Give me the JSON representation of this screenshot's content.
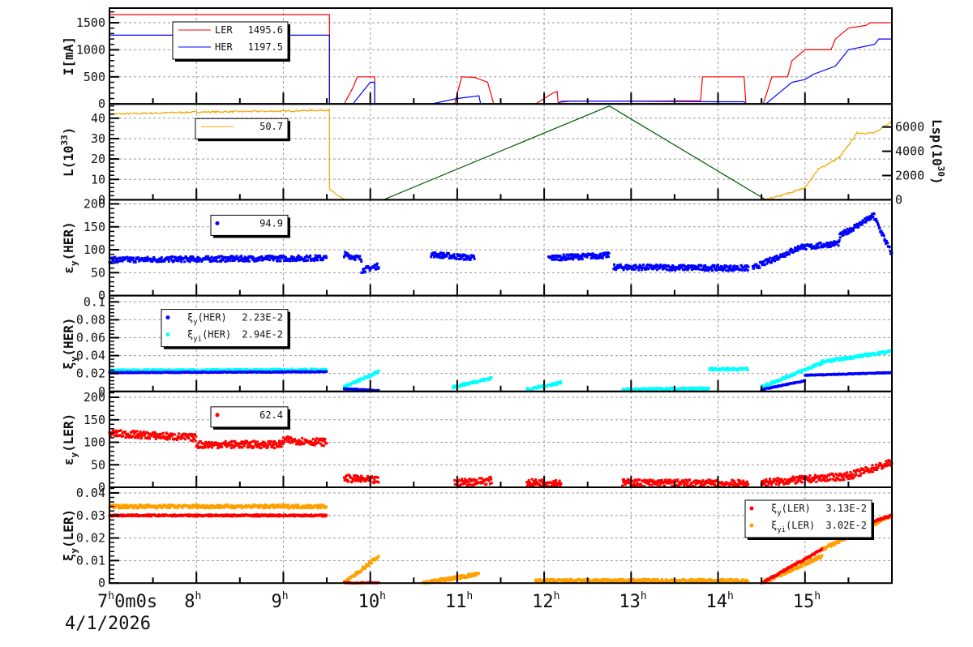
{
  "chart_data": {
    "type": "line",
    "x_range_hours": [
      7,
      16
    ],
    "x_tick_labels": [
      {
        "h": "7",
        "rest": "0m0s"
      },
      {
        "h": "8"
      },
      {
        "h": "9"
      },
      {
        "h": "10"
      },
      {
        "h": "11"
      },
      {
        "h": "12"
      },
      {
        "h": "13"
      },
      {
        "h": "14"
      },
      {
        "h": "15"
      }
    ],
    "x_hour_sup": "h",
    "date_label": "4/1/2026",
    "panels": [
      {
        "id": "current",
        "ylabel": {
          "main": "I[mA]"
        },
        "ylim": [
          0,
          1770
        ],
        "yticks": [
          0,
          500,
          1000,
          1500
        ],
        "legend": [
          {
            "name": "LER",
            "value": "1495.6",
            "color": "#ff0000",
            "kind": "line"
          },
          {
            "name": "HER",
            "value": "1197.5",
            "color": "#0000ff",
            "kind": "line"
          }
        ],
        "series": [
          {
            "name": "LER",
            "color": "#ff0000",
            "kind": "line",
            "points": [
              [
                7,
                1650
              ],
              [
                9.53,
                1650
              ],
              [
                9.53,
                0
              ],
              [
                9.7,
                0
              ],
              [
                9.8,
                300
              ],
              [
                9.85,
                500
              ],
              [
                10.05,
                500
              ],
              [
                10.05,
                0
              ],
              [
                10.97,
                0
              ],
              [
                11.05,
                500
              ],
              [
                11.2,
                490
              ],
              [
                11.35,
                400
              ],
              [
                11.42,
                0
              ],
              [
                11.9,
                0
              ],
              [
                12.1,
                200
              ],
              [
                12.15,
                230
              ],
              [
                12.16,
                30
              ],
              [
                12.3,
                50
              ],
              [
                13.0,
                50
              ],
              [
                13.8,
                60
              ],
              [
                13.82,
                500
              ],
              [
                14.3,
                500
              ],
              [
                14.32,
                0
              ],
              [
                14.52,
                0
              ],
              [
                14.62,
                500
              ],
              [
                14.8,
                500
              ],
              [
                14.85,
                800
              ],
              [
                15.0,
                1000
              ],
              [
                15.3,
                1000
              ],
              [
                15.35,
                1200
              ],
              [
                15.5,
                1400
              ],
              [
                15.7,
                1450
              ],
              [
                15.75,
                1500
              ],
              [
                16,
                1500
              ]
            ]
          },
          {
            "name": "HER",
            "color": "#0000ff",
            "kind": "line",
            "points": [
              [
                7,
                1270
              ],
              [
                9.53,
                1270
              ],
              [
                9.53,
                0
              ],
              [
                9.8,
                0
              ],
              [
                9.9,
                200
              ],
              [
                10.0,
                400
              ],
              [
                10.05,
                400
              ],
              [
                10.05,
                0
              ],
              [
                10.7,
                0
              ],
              [
                11.0,
                100
              ],
              [
                11.25,
                150
              ],
              [
                11.27,
                0
              ],
              [
                12.15,
                0
              ],
              [
                12.2,
                50
              ],
              [
                13.0,
                50
              ],
              [
                14.0,
                40
              ],
              [
                14.3,
                40
              ],
              [
                14.32,
                0
              ],
              [
                14.55,
                0
              ],
              [
                14.7,
                200
              ],
              [
                14.85,
                400
              ],
              [
                15.0,
                450
              ],
              [
                15.1,
                550
              ],
              [
                15.35,
                700
              ],
              [
                15.5,
                1000
              ],
              [
                15.8,
                1100
              ],
              [
                15.85,
                1200
              ],
              [
                16,
                1200
              ]
            ]
          }
        ]
      },
      {
        "id": "luminosity",
        "ylabel": {
          "main": "L(10",
          "sup": "33",
          "end": ")"
        },
        "ylim": [
          0,
          47
        ],
        "yticks": [
          0,
          10,
          20,
          30,
          40
        ],
        "y2label": {
          "main": "Lsp(10",
          "sup": "30",
          "end": ")"
        },
        "y2lim": [
          0,
          7900
        ],
        "y2ticks": [
          0,
          2000,
          4000,
          6000
        ],
        "legend": [
          {
            "name": "",
            "value": "50.7",
            "color": "#f0a800",
            "kind": "line"
          }
        ],
        "series": [
          {
            "name": "L",
            "color": "#f0a800",
            "kind": "line",
            "noise": 0.8,
            "points": [
              [
                7,
                42
              ],
              [
                8,
                43
              ],
              [
                9,
                43.5
              ],
              [
                9.53,
                44
              ],
              [
                9.53,
                5
              ],
              [
                9.7,
                0
              ],
              [
                14.55,
                0
              ]
            ]
          },
          {
            "name": "Lsp",
            "color": "#f0a800",
            "kind": "line",
            "axis": "y2",
            "noise": 150,
            "points": [
              [
                14.55,
                0
              ],
              [
                14.8,
                500
              ],
              [
                15.0,
                1000
              ],
              [
                15.15,
                2500
              ],
              [
                15.4,
                3500
              ],
              [
                15.6,
                5500
              ],
              [
                15.8,
                5500
              ],
              [
                16,
                6500
              ]
            ]
          },
          {
            "name": "trend",
            "color": "#005a00",
            "kind": "line",
            "points": [
              [
                10.15,
                0
              ],
              [
                12.75,
                46
              ],
              [
                14.55,
                0
              ]
            ]
          }
        ]
      },
      {
        "id": "emit-her",
        "ylabel": {
          "main": "ε",
          "sub": "y",
          "end": "(HER)"
        },
        "ylim": [
          0,
          209
        ],
        "yticks": [
          0,
          50,
          100,
          150,
          200
        ],
        "legend": [
          {
            "name": "",
            "value": "94.9",
            "color": "#0000ff",
            "kind": "dot"
          }
        ],
        "series": [
          {
            "name": "εy(HER)",
            "color": "#0000ff",
            "kind": "scatter",
            "noise": 6,
            "segments": [
              [
                7,
                9.5,
                78,
                82
              ],
              [
                9.7,
                9.9,
                90,
                80
              ],
              [
                9.9,
                10.1,
                55,
                65
              ],
              [
                10.7,
                11.2,
                90,
                82
              ],
              [
                12.05,
                12.75,
                82,
                88
              ],
              [
                12.8,
                14.35,
                62,
                60
              ],
              [
                14.4,
                15.0,
                60,
                110
              ],
              [
                15.0,
                15.4,
                105,
                115
              ],
              [
                15.4,
                15.8,
                130,
                175
              ],
              [
                15.8,
                16,
                170,
                90
              ]
            ]
          }
        ]
      },
      {
        "id": "tune-her",
        "ylabel": {
          "main": "ξ",
          "sub": "y",
          "end": "(HER)"
        },
        "ylim": [
          0,
          0.107
        ],
        "yticks": [
          0,
          0.02,
          0.04,
          0.06,
          0.08,
          0.1
        ],
        "legend": [
          {
            "name": "ξ",
            "sub": "y",
            "name2": "(HER)",
            "value": "2.23E-2",
            "color": "#0000ff",
            "kind": "dot"
          },
          {
            "name": "ξ",
            "sub": "yi",
            "name2": "(HER)",
            "value": "2.94E-2",
            "color": "#00ffff",
            "kind": "dot"
          }
        ],
        "series": [
          {
            "name": "ξyi(HER)",
            "color": "#00ffff",
            "kind": "scatter",
            "noise": 0.0015,
            "segments": [
              [
                7,
                9.5,
                0.023,
                0.024
              ],
              [
                9.7,
                10.1,
                0.005,
                0.022
              ],
              [
                10.95,
                11.4,
                0.005,
                0.015
              ],
              [
                11.8,
                12.2,
                0.002,
                0.01
              ],
              [
                12.9,
                13.9,
                0.002,
                0.003
              ],
              [
                13.9,
                14.35,
                0.025,
                0.025
              ],
              [
                14.5,
                15.2,
                0.005,
                0.032
              ],
              [
                15.2,
                16,
                0.033,
                0.045
              ]
            ]
          },
          {
            "name": "ξy(HER)",
            "color": "#0000ff",
            "kind": "scatter",
            "noise": 0.0005,
            "segments": [
              [
                7,
                9.5,
                0.021,
                0.022
              ],
              [
                9.7,
                10.1,
                0.003,
                0.001
              ],
              [
                14.5,
                15.0,
                0.002,
                0.012
              ],
              [
                15.0,
                16,
                0.018,
                0.021
              ]
            ]
          }
        ]
      },
      {
        "id": "emit-ler",
        "ylabel": {
          "main": "ε",
          "sub": "y",
          "end": "(LER)"
        },
        "ylim": [
          0,
          213
        ],
        "yticks": [
          0,
          50,
          100,
          150,
          200
        ],
        "legend": [
          {
            "name": "",
            "value": "62.4",
            "color": "#ff0000",
            "kind": "dot"
          }
        ],
        "series": [
          {
            "name": "εy(LER)",
            "color": "#ff0000",
            "kind": "scatter",
            "noise": 8,
            "segments": [
              [
                7,
                8.0,
                120,
                110
              ],
              [
                8.0,
                9.0,
                95,
                95
              ],
              [
                9.0,
                9.5,
                105,
                100
              ],
              [
                9.7,
                10.1,
                20,
                15
              ],
              [
                10.97,
                11.4,
                10,
                15
              ],
              [
                11.8,
                12.2,
                10,
                10
              ],
              [
                12.9,
                14.35,
                10,
                8
              ],
              [
                14.5,
                15.5,
                10,
                25
              ],
              [
                15.5,
                16,
                25,
                55
              ]
            ]
          }
        ]
      },
      {
        "id": "tune-ler",
        "ylabel": {
          "main": "ξ",
          "sub": "y",
          "end": "(LER)"
        },
        "ylim": [
          0,
          0.0425
        ],
        "yticks": [
          0,
          0.01,
          0.02,
          0.03,
          0.04
        ],
        "legend": [
          {
            "name": "ξ",
            "sub": "y",
            "name2": "(LER)",
            "value": "3.13E-2",
            "color": "#ff0000",
            "kind": "dot"
          },
          {
            "name": "ξ",
            "sub": "yi",
            "name2": "(LER)",
            "value": "3.02E-2",
            "color": "#ffa000",
            "kind": "dot"
          }
        ],
        "series": [
          {
            "name": "ξyi(LER)",
            "color": "#ffa000",
            "kind": "scatter",
            "noise": 0.0008,
            "segments": [
              [
                7,
                9.5,
                0.034,
                0.034
              ],
              [
                9.7,
                10.1,
                0.0,
                0.012
              ],
              [
                10.6,
                11.25,
                0.0,
                0.004
              ],
              [
                11.9,
                14.35,
                0.001,
                0.001
              ],
              [
                14.5,
                15.2,
                0.0,
                0.012
              ],
              [
                15.2,
                16,
                0.015,
                0.03
              ]
            ]
          },
          {
            "name": "ξy(LER)",
            "color": "#ff0000",
            "kind": "scatter",
            "noise": 0.0004,
            "segments": [
              [
                7,
                9.5,
                0.03,
                0.03
              ],
              [
                9.7,
                10.1,
                0.0,
                0.0
              ],
              [
                14.5,
                15.2,
                0.0,
                0.015
              ],
              [
                15.2,
                16,
                0.02,
                0.03
              ]
            ]
          }
        ]
      }
    ]
  }
}
